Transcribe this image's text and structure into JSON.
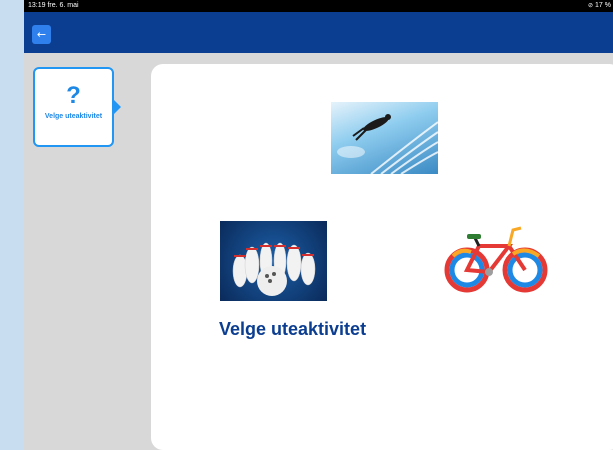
{
  "status": {
    "time_date": "13:19  fre. 6. mai",
    "battery": "17 %"
  },
  "nav": {
    "back_icon": "arrow-left-icon"
  },
  "step": {
    "symbol": "?",
    "label": "Velge uteaktivitet"
  },
  "main": {
    "caption": "Velge uteaktivitet",
    "images": [
      {
        "name": "swimming-image"
      },
      {
        "name": "bowling-image"
      },
      {
        "name": "bicycle-image"
      }
    ]
  },
  "colors": {
    "navbar": "#0b3d91",
    "accent": "#1e88e5",
    "caption": "#0b3d91"
  }
}
